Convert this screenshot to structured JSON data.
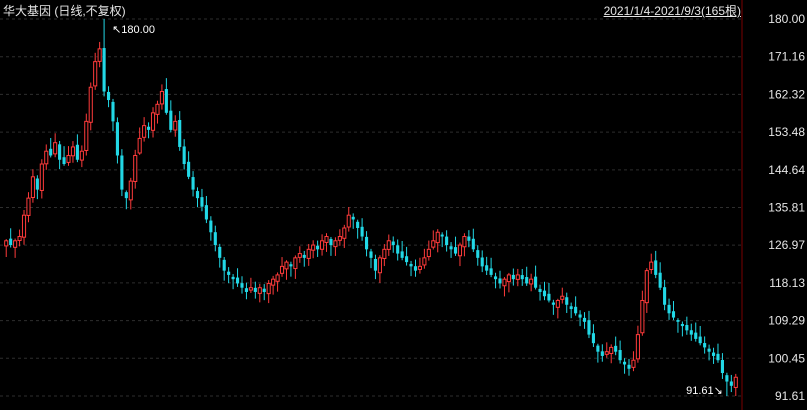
{
  "header": {
    "title": "华大基因 (日线,不复权)",
    "range": "2021/1/4-2021/9/3(165根)"
  },
  "chart_data": {
    "type": "candlestick",
    "y_ticks": [
      "180.00",
      "171.16",
      "162.32",
      "153.48",
      "144.64",
      "135.81",
      "126.97",
      "118.13",
      "109.29",
      "100.45",
      "91.61"
    ],
    "ylim": [
      91.61,
      180.0
    ],
    "grid": true,
    "up_color": "#ff3b3b",
    "down_color": "#22d8e6",
    "annotations": [
      {
        "text": "180.00",
        "type": "high"
      },
      {
        "text": "91.61",
        "type": "low"
      }
    ],
    "series_close": [
      128,
      127,
      128,
      129,
      134,
      138,
      143,
      140,
      146,
      149,
      148,
      151,
      147,
      146,
      148,
      150,
      147,
      149,
      156,
      164,
      170,
      173,
      163,
      161,
      156,
      148,
      140,
      138,
      142,
      148,
      152,
      155,
      154,
      158,
      160,
      163,
      158,
      154,
      156,
      150,
      146,
      143,
      140,
      138,
      136,
      133,
      130,
      127,
      124,
      121,
      120,
      119,
      118,
      117,
      116,
      117,
      116,
      117,
      116,
      118,
      119,
      120,
      122,
      123,
      122,
      124,
      125,
      124,
      126,
      127,
      126,
      128,
      129,
      127,
      128,
      129,
      131,
      134,
      133,
      131,
      129,
      126,
      124,
      121,
      124,
      126,
      128,
      127,
      125,
      124,
      123,
      122,
      121,
      122,
      124,
      126,
      128,
      130,
      129,
      127,
      126,
      125,
      127,
      129,
      128,
      126,
      124,
      122,
      121,
      120,
      119,
      118,
      119,
      120,
      119,
      120,
      119,
      118,
      119,
      117,
      116,
      115,
      114,
      113,
      114,
      115,
      113,
      112,
      111,
      110,
      109,
      106,
      104,
      102,
      101,
      102,
      103,
      102,
      100,
      99,
      98,
      100,
      106,
      114,
      121,
      123,
      120,
      117,
      113,
      111,
      110,
      109,
      108,
      107,
      106,
      105,
      104,
      103,
      102,
      101,
      100,
      97,
      95,
      94,
      96
    ]
  }
}
